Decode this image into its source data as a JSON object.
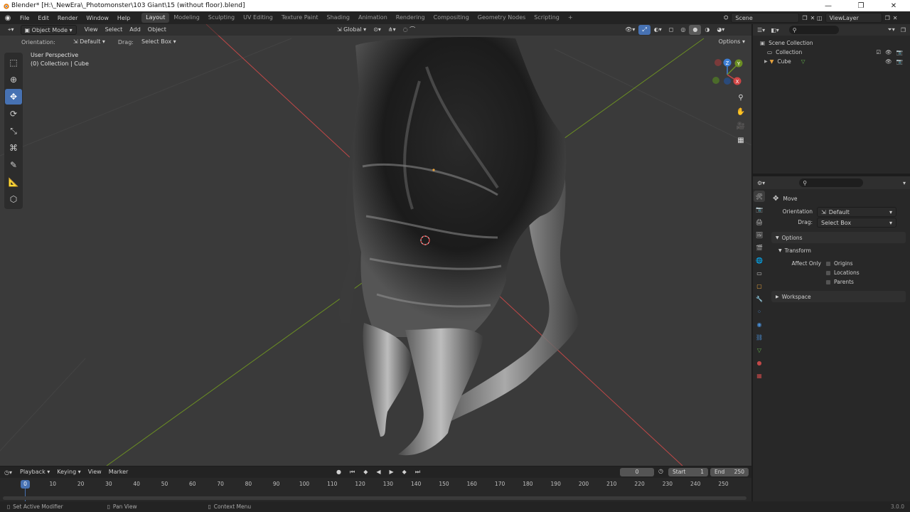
{
  "title_bar": {
    "text": "Blender* [H:\\_NewEra\\_Photomonster\\103 Giant\\15 (without floor).blend]"
  },
  "menu": [
    "File",
    "Edit",
    "Render",
    "Window",
    "Help"
  ],
  "workspaces": [
    "Layout",
    "Modeling",
    "Sculpting",
    "UV Editing",
    "Texture Paint",
    "Shading",
    "Animation",
    "Rendering",
    "Compositing",
    "Geometry Nodes",
    "Scripting"
  ],
  "top_right": {
    "scene": "Scene",
    "view_layer": "ViewLayer"
  },
  "viewport": {
    "mode": "Object Mode",
    "menus": [
      "View",
      "Select",
      "Add",
      "Object"
    ],
    "transform_orientation": "Global",
    "orientation_label": "Orientation:",
    "orientation_value": "Default",
    "drag_label": "Drag:",
    "drag_value": "Select Box",
    "options": "Options",
    "perspective": "User Perspective",
    "collection_info": "(0) Collection | Cube",
    "gizmo_axes": [
      "Z",
      "Y",
      "X"
    ]
  },
  "outliner": {
    "scene_collection": "Scene Collection",
    "items": [
      {
        "label": "Collection"
      },
      {
        "label": "Cube"
      }
    ]
  },
  "properties": {
    "tool_name": "Move",
    "orientation_label": "Orientation",
    "orientation_value": "Default",
    "drag_label": "Drag:",
    "drag_value": "Select Box",
    "options_panel": "Options",
    "transform_panel": "Transform",
    "affect_only_label": "Affect Only",
    "affect_options": [
      "Origins",
      "Locations",
      "Parents"
    ],
    "workspace_panel": "Workspace"
  },
  "timeline": {
    "menus": [
      "Playback",
      "Keying",
      "View",
      "Marker"
    ],
    "current_frame": "0",
    "start_label": "Start",
    "start_value": "1",
    "end_label": "End",
    "end_value": "250",
    "ticks": [
      "0",
      "10",
      "20",
      "30",
      "40",
      "50",
      "60",
      "70",
      "80",
      "90",
      "100",
      "110",
      "120",
      "130",
      "140",
      "150",
      "160",
      "170",
      "180",
      "190",
      "200",
      "210",
      "220",
      "230",
      "240",
      "250"
    ],
    "playhead": "0"
  },
  "statusbar": {
    "left": "Set Active Modifier",
    "middle": "Pan View",
    "right": "Context Menu",
    "version": "3.0.0"
  },
  "colors": {
    "accent": "#4772b3",
    "x_axis": "#c14848",
    "y_axis": "#6b8e23",
    "z_axis": "#3d7fd6"
  }
}
